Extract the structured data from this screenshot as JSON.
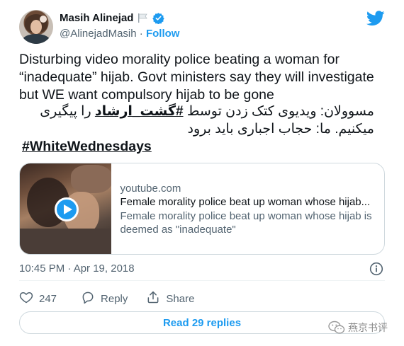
{
  "author": {
    "name": "Masih Alinejad",
    "handle": "@AlinejadMasih",
    "separator": "·",
    "follow_label": "Follow"
  },
  "tweet": {
    "text_en": "Disturbing video morality police beating a woman for “inadequate” hijab. Govt ministers say they will investigate but WE want compulsory hijab to be gone",
    "fa_line1_before": "مسوولان: ویدیوی کتک زدن توسط ",
    "fa_hashtag": "#گشت_ارشاد",
    "fa_line1_after": " را پیگیری",
    "fa_line2": "میکنیم. ما: حجاب اجباری باید برود",
    "hashtag": "#WhiteWednesdays"
  },
  "link_card": {
    "domain": "youtube.com",
    "title": "Female morality police beat up woman whose hijab...",
    "description": "Female morality police beat up woman whose hijab is deemed as \"inadequate\""
  },
  "meta": {
    "timestamp": "10:45 PM · Apr 19, 2018"
  },
  "actions": {
    "like_count": "247",
    "reply_label": "Reply",
    "share_label": "Share"
  },
  "read_replies_label": "Read 29 replies",
  "watermark": {
    "text": "燕京书评"
  },
  "colors": {
    "accent": "#1d9bf0",
    "text_primary": "#0f1419",
    "text_secondary": "#536471",
    "border": "#cfd9de"
  },
  "icons": {
    "brand": "twitter-bird-icon",
    "verified": "verified-badge-icon",
    "flag": "white-flag-icon",
    "play": "play-icon",
    "info": "info-icon",
    "like": "heart-icon",
    "reply": "reply-icon",
    "share": "share-icon"
  }
}
